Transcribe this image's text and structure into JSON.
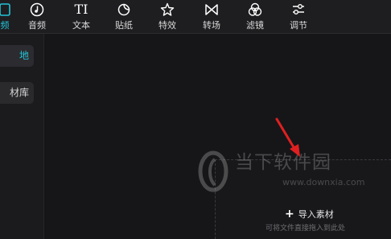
{
  "toolbar": {
    "items": [
      {
        "label": "频",
        "icon": "media-icon",
        "active": true
      },
      {
        "label": "音频",
        "icon": "music-note-icon"
      },
      {
        "label": "文本",
        "icon": "text-icon"
      },
      {
        "label": "贴纸",
        "icon": "sticker-icon"
      },
      {
        "label": "特效",
        "icon": "sparkle-star-icon"
      },
      {
        "label": "转场",
        "icon": "transition-bowtie-icon"
      },
      {
        "label": "滤镜",
        "icon": "filter-circles-icon"
      },
      {
        "label": "调节",
        "icon": "adjust-sliders-icon"
      }
    ],
    "text_icon_glyph": "TI"
  },
  "sidebar": {
    "items": [
      {
        "label": "地",
        "active": true
      },
      {
        "label": "材库"
      }
    ]
  },
  "dropzone": {
    "import_label": "导入素材",
    "plus_glyph": "+",
    "hint": "可将文件直接拖入到此处"
  },
  "watermark": {
    "cn_text": "当下软件园",
    "url_text": "www.downxia.com"
  },
  "colors": {
    "accent": "#22c3d8",
    "annotation": "#e02020",
    "background": "#161619",
    "toolbar": "#1e1e21"
  }
}
